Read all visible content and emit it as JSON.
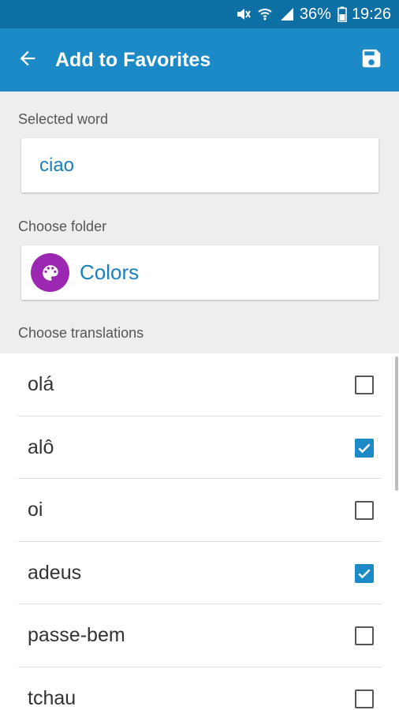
{
  "status_bar": {
    "icons": [
      "mute-icon",
      "wifi-icon",
      "signal-icon",
      "battery-icon"
    ],
    "battery": "36%",
    "time": "19:26"
  },
  "app_bar": {
    "back_icon": "arrow-back-icon",
    "title": "Add to Favorites",
    "save_icon": "save-icon",
    "color": "#1b8ac6"
  },
  "selected_word": {
    "label": "Selected word",
    "value": "ciao"
  },
  "folder": {
    "label": "Choose folder",
    "icon": "palette-icon",
    "icon_color": "#9c27b0",
    "name": "Colors"
  },
  "translations": {
    "label": "Choose translations",
    "items": [
      {
        "text": "olá",
        "checked": false
      },
      {
        "text": "alô",
        "checked": true
      },
      {
        "text": "oi",
        "checked": false
      },
      {
        "text": "adeus",
        "checked": true
      },
      {
        "text": "passe-bem",
        "checked": false
      },
      {
        "text": "tchau",
        "checked": false
      }
    ]
  }
}
